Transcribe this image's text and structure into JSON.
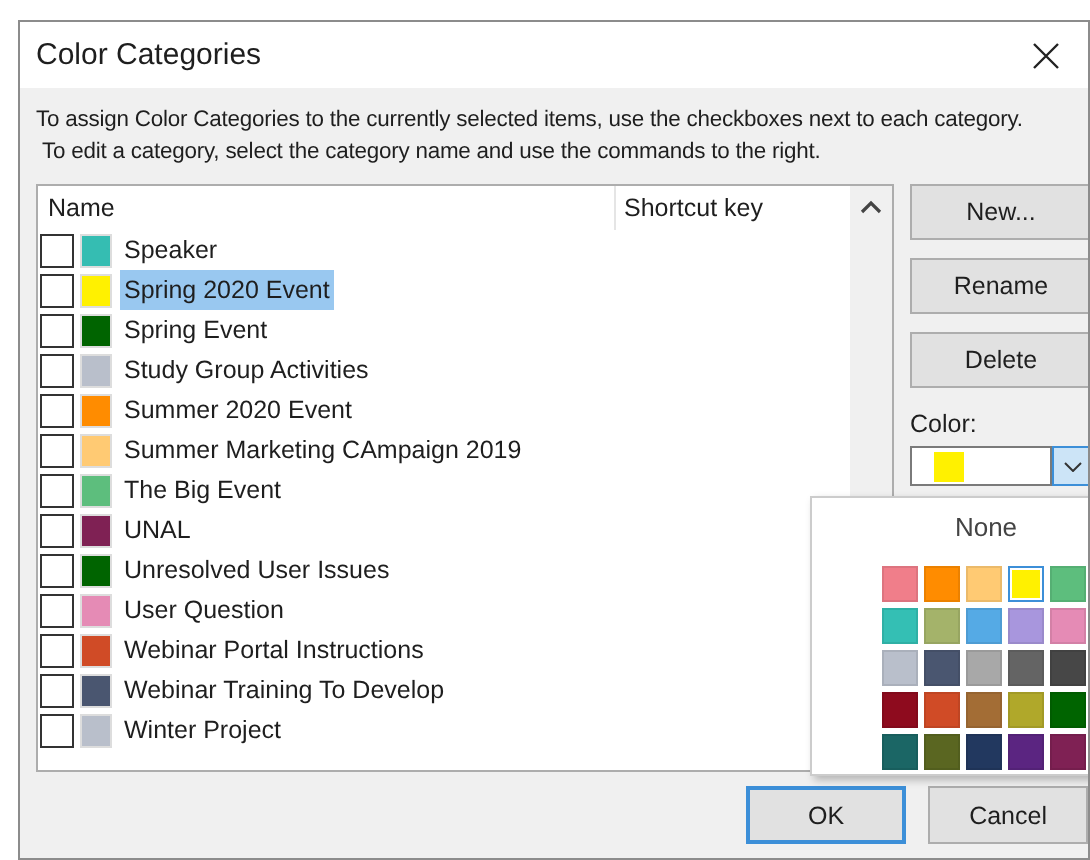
{
  "window": {
    "title": "Color Categories"
  },
  "instructions": [
    "To assign Color Categories to the currently selected items, use the checkboxes next to each category.",
    "To edit a category, select the category name and use the commands to the right."
  ],
  "list": {
    "columns": [
      "Name",
      "Shortcut key"
    ],
    "items": [
      {
        "name": "Speaker",
        "color": "#35bdb2",
        "checked": false,
        "selected": false
      },
      {
        "name": "Spring 2020 Event",
        "color": "#fff100",
        "checked": false,
        "selected": true
      },
      {
        "name": "Spring Event",
        "color": "#006400",
        "checked": false,
        "selected": false
      },
      {
        "name": "Study Group Activities",
        "color": "#b9bfcb",
        "checked": false,
        "selected": false
      },
      {
        "name": "Summer 2020 Event",
        "color": "#ff8c00",
        "checked": false,
        "selected": false
      },
      {
        "name": "Summer Marketing CAmpaign 2019",
        "color": "#ffca73",
        "checked": false,
        "selected": false
      },
      {
        "name": "The Big Event",
        "color": "#5dbe7d",
        "checked": false,
        "selected": false
      },
      {
        "name": "UNAL",
        "color": "#7f2154",
        "checked": false,
        "selected": false
      },
      {
        "name": "Unresolved User Issues",
        "color": "#006400",
        "checked": false,
        "selected": false
      },
      {
        "name": "User Question",
        "color": "#e58bb5",
        "checked": false,
        "selected": false
      },
      {
        "name": "Webinar Portal Instructions",
        "color": "#d04b26",
        "checked": false,
        "selected": false
      },
      {
        "name": "Webinar Training To Develop",
        "color": "#4a5670",
        "checked": false,
        "selected": false
      },
      {
        "name": "Winter Project",
        "color": "#b9bfcb",
        "checked": false,
        "selected": false
      }
    ]
  },
  "buttons": [
    "New...",
    "Rename",
    "Delete"
  ],
  "color": {
    "label": "Color:",
    "value": {
      "color": "#fff100"
    },
    "open": true
  },
  "palette": {
    "none_label": "None",
    "swatches": [
      {
        "color": "#f07e8a",
        "selected": false
      },
      {
        "color": "#ff8c00",
        "selected": false
      },
      {
        "color": "#ffca73",
        "selected": false
      },
      {
        "color": "#fff100",
        "selected": true
      },
      {
        "color": "#5dbe7d",
        "selected": false
      },
      {
        "color": "#34bfb4",
        "selected": false
      },
      {
        "color": "#a4b36a",
        "selected": false
      },
      {
        "color": "#55aae5",
        "selected": false
      },
      {
        "color": "#a896dd",
        "selected": false
      },
      {
        "color": "#e58bb5",
        "selected": false
      },
      {
        "color": "#b9bfcb",
        "selected": false
      },
      {
        "color": "#4a5670",
        "selected": false
      },
      {
        "color": "#a8a8a8",
        "selected": false
      },
      {
        "color": "#646464",
        "selected": false
      },
      {
        "color": "#474747",
        "selected": false
      },
      {
        "color": "#8e0b1e",
        "selected": false
      },
      {
        "color": "#d04b26",
        "selected": false
      },
      {
        "color": "#a36d35",
        "selected": false
      },
      {
        "color": "#b0a82a",
        "selected": false
      },
      {
        "color": "#006400",
        "selected": false
      },
      {
        "color": "#1b6665",
        "selected": false
      },
      {
        "color": "#5a6621",
        "selected": false
      },
      {
        "color": "#22385f",
        "selected": false
      },
      {
        "color": "#5b2581",
        "selected": false
      },
      {
        "color": "#7f2154",
        "selected": false
      }
    ]
  },
  "footer_buttons": [
    {
      "label": "OK",
      "default": true
    },
    {
      "label": "Cancel",
      "default": false
    }
  ]
}
